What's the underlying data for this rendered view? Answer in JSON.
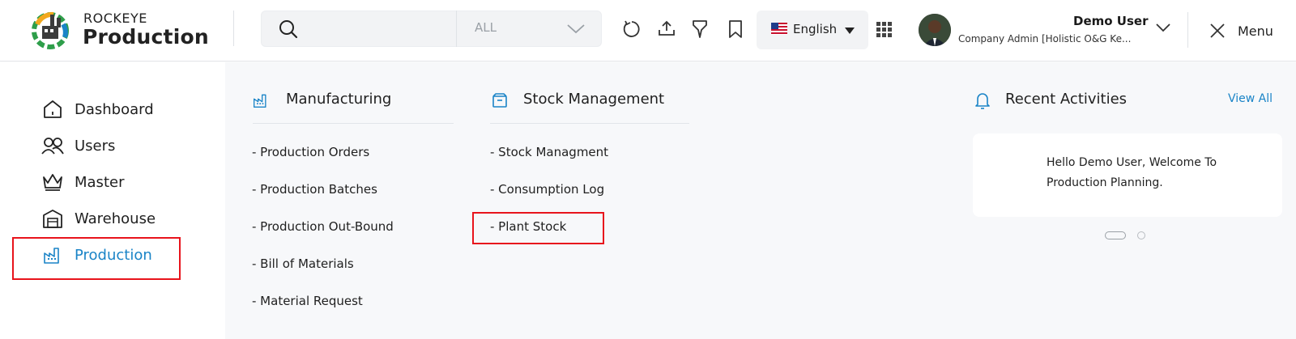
{
  "brand": {
    "top": "ROCKEYE",
    "main": "Production"
  },
  "search": {
    "placeholder": "",
    "scope": "ALL"
  },
  "toolbar": {
    "icons": [
      "refresh-icon",
      "upload-icon",
      "filter-icon",
      "bookmark-icon"
    ],
    "language": "English",
    "apps_icon": "apps-grid-icon"
  },
  "user": {
    "name": "Demo User",
    "role": "Company Admin [Holistic O&G Ke..."
  },
  "menu_label": "Menu",
  "sidebar": {
    "items": [
      {
        "label": "Dashboard",
        "icon": "home-icon"
      },
      {
        "label": "Users",
        "icon": "users-icon"
      },
      {
        "label": "Master",
        "icon": "crown-icon"
      },
      {
        "label": "Warehouse",
        "icon": "warehouse-icon"
      },
      {
        "label": "Production",
        "icon": "factory-icon",
        "active": true
      }
    ]
  },
  "sections": {
    "manufacturing": {
      "title": "Manufacturing",
      "links": [
        "- Production Orders",
        "- Production Batches",
        "- Production Out-Bound",
        "- Bill of Materials",
        "- Material Request"
      ]
    },
    "stock": {
      "title": "Stock Management",
      "links": [
        "- Stock Managment",
        "- Consumption Log",
        "- Plant Stock"
      ]
    }
  },
  "activities": {
    "title": "Recent Activities",
    "view_all": "View All",
    "message": "Hello Demo User, Welcome To Production Planning."
  },
  "colors": {
    "accent": "#1a84c7",
    "highlight": "#e8141c",
    "panel": "#f7f8fa"
  }
}
